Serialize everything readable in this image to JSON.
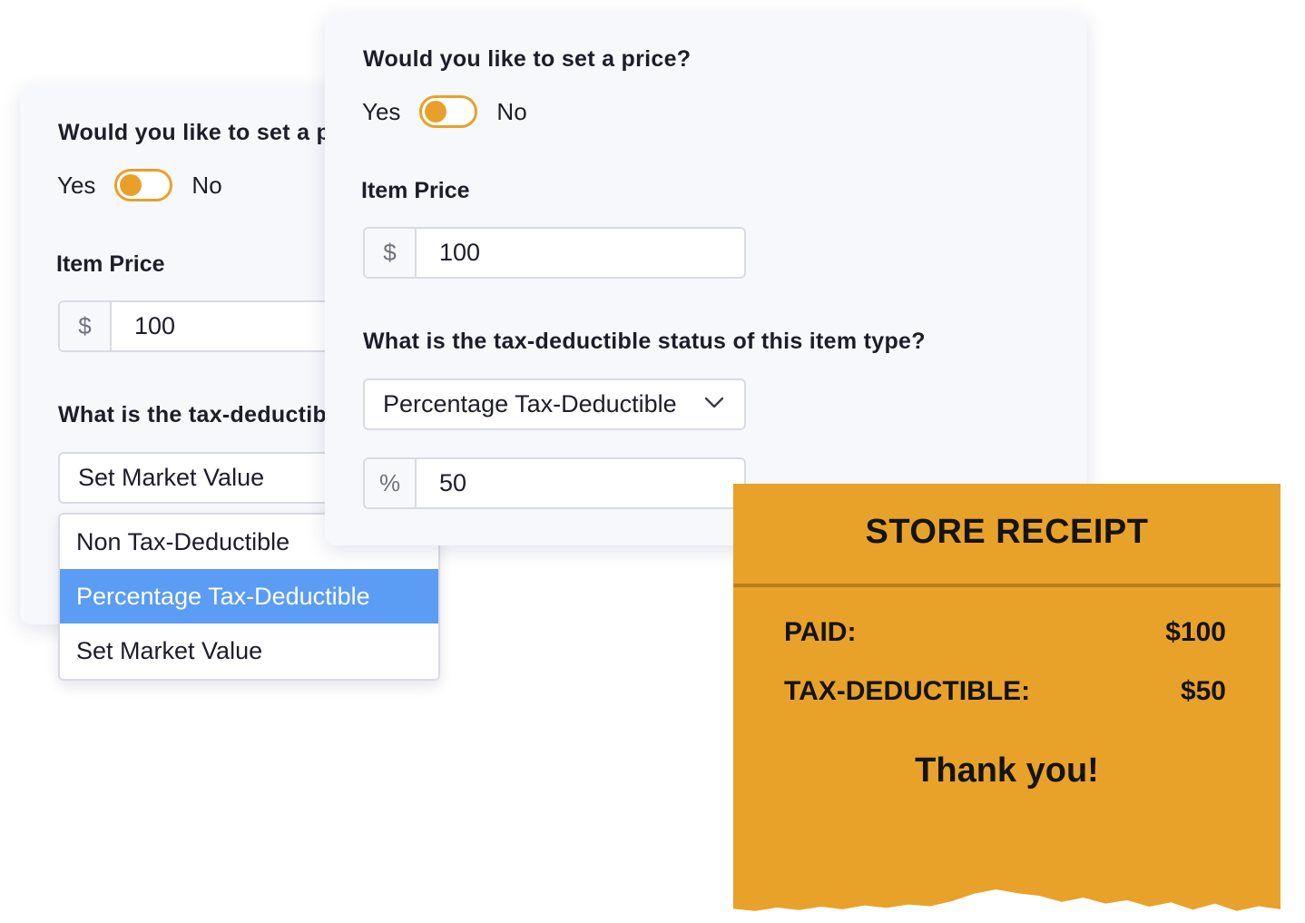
{
  "back_card": {
    "price_question": "Would you like to set a price?",
    "toggle": {
      "yes_label": "Yes",
      "no_label": "No"
    },
    "item_price_label": "Item Price",
    "price_input": {
      "currency_symbol": "$",
      "value": "100"
    },
    "tax_question": "What is the tax-deductible status of this item type?",
    "select_value": "Set Market Value",
    "dropdown_options": [
      "Non Tax-Deductible",
      "Percentage Tax-Deductible",
      "Set Market Value"
    ],
    "dropdown_selected": "Percentage Tax-Deductible"
  },
  "front_card": {
    "price_question": "Would you like to set a price?",
    "toggle": {
      "yes_label": "Yes",
      "no_label": "No"
    },
    "item_price_label": "Item Price",
    "price_input": {
      "currency_symbol": "$",
      "value": "100"
    },
    "tax_question": "What is the tax-deductible status of this item type?",
    "select_value": "Percentage Tax-Deductible",
    "percent_input": {
      "symbol": "%",
      "value": "50"
    }
  },
  "receipt": {
    "title": "STORE RECEIPT",
    "rows": [
      {
        "label": "PAID:",
        "value": "$100"
      },
      {
        "label": "TAX-DEDUCTIBLE:",
        "value": "$50"
      }
    ],
    "thanks": "Thank you!"
  },
  "colors": {
    "accent_orange": "#e8a22a",
    "dropdown_highlight": "#5b9cf5",
    "card_background": "#f7f8fc",
    "border": "#d9dbe4"
  },
  "icons": {
    "select_chevron": "chevron-down-icon"
  }
}
